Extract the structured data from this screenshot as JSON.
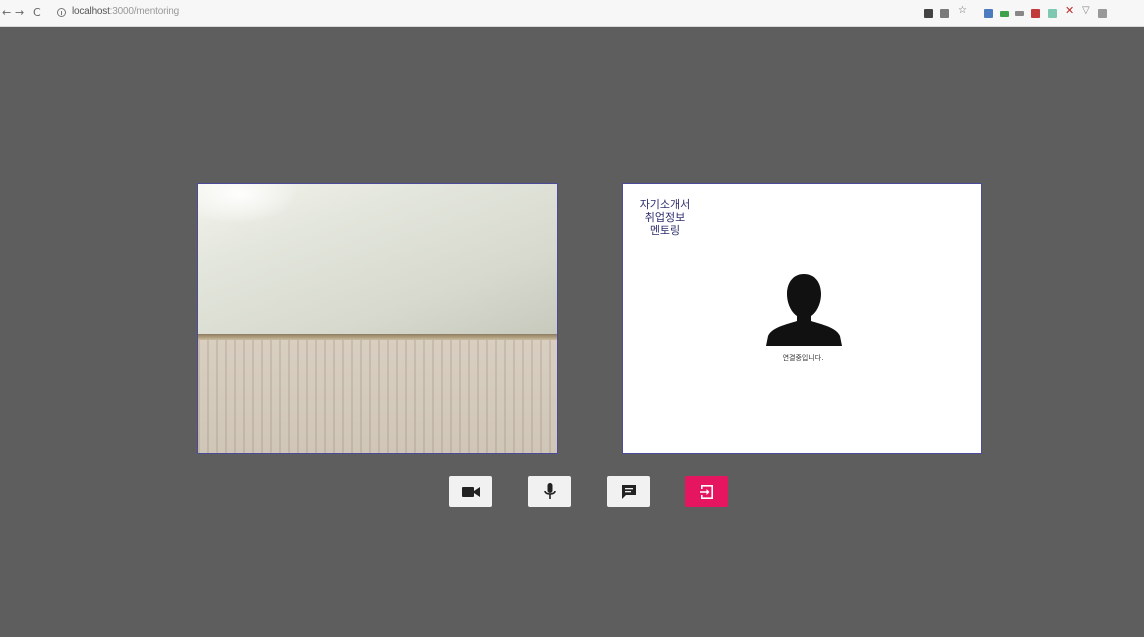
{
  "browser": {
    "url_host": "localhost",
    "url_path": ":3000/mentoring",
    "extension_colors": [
      "#444444",
      "#4d7bbf",
      "#3a3a3a",
      "#3ea24a",
      "#666666",
      "#c23b3b",
      "#7ec8b2",
      "#c02a2a",
      "#888888",
      "#888888"
    ]
  },
  "remote": {
    "menu": [
      "자기소개서",
      "취업정보",
      "멘토링"
    ],
    "status": "연결중입니다."
  },
  "controls": {
    "camera_icon": "camera-icon",
    "mic_icon": "microphone-icon",
    "chat_icon": "chat-icon",
    "exit_icon": "exit-icon",
    "exit_color": "#e6155f"
  }
}
